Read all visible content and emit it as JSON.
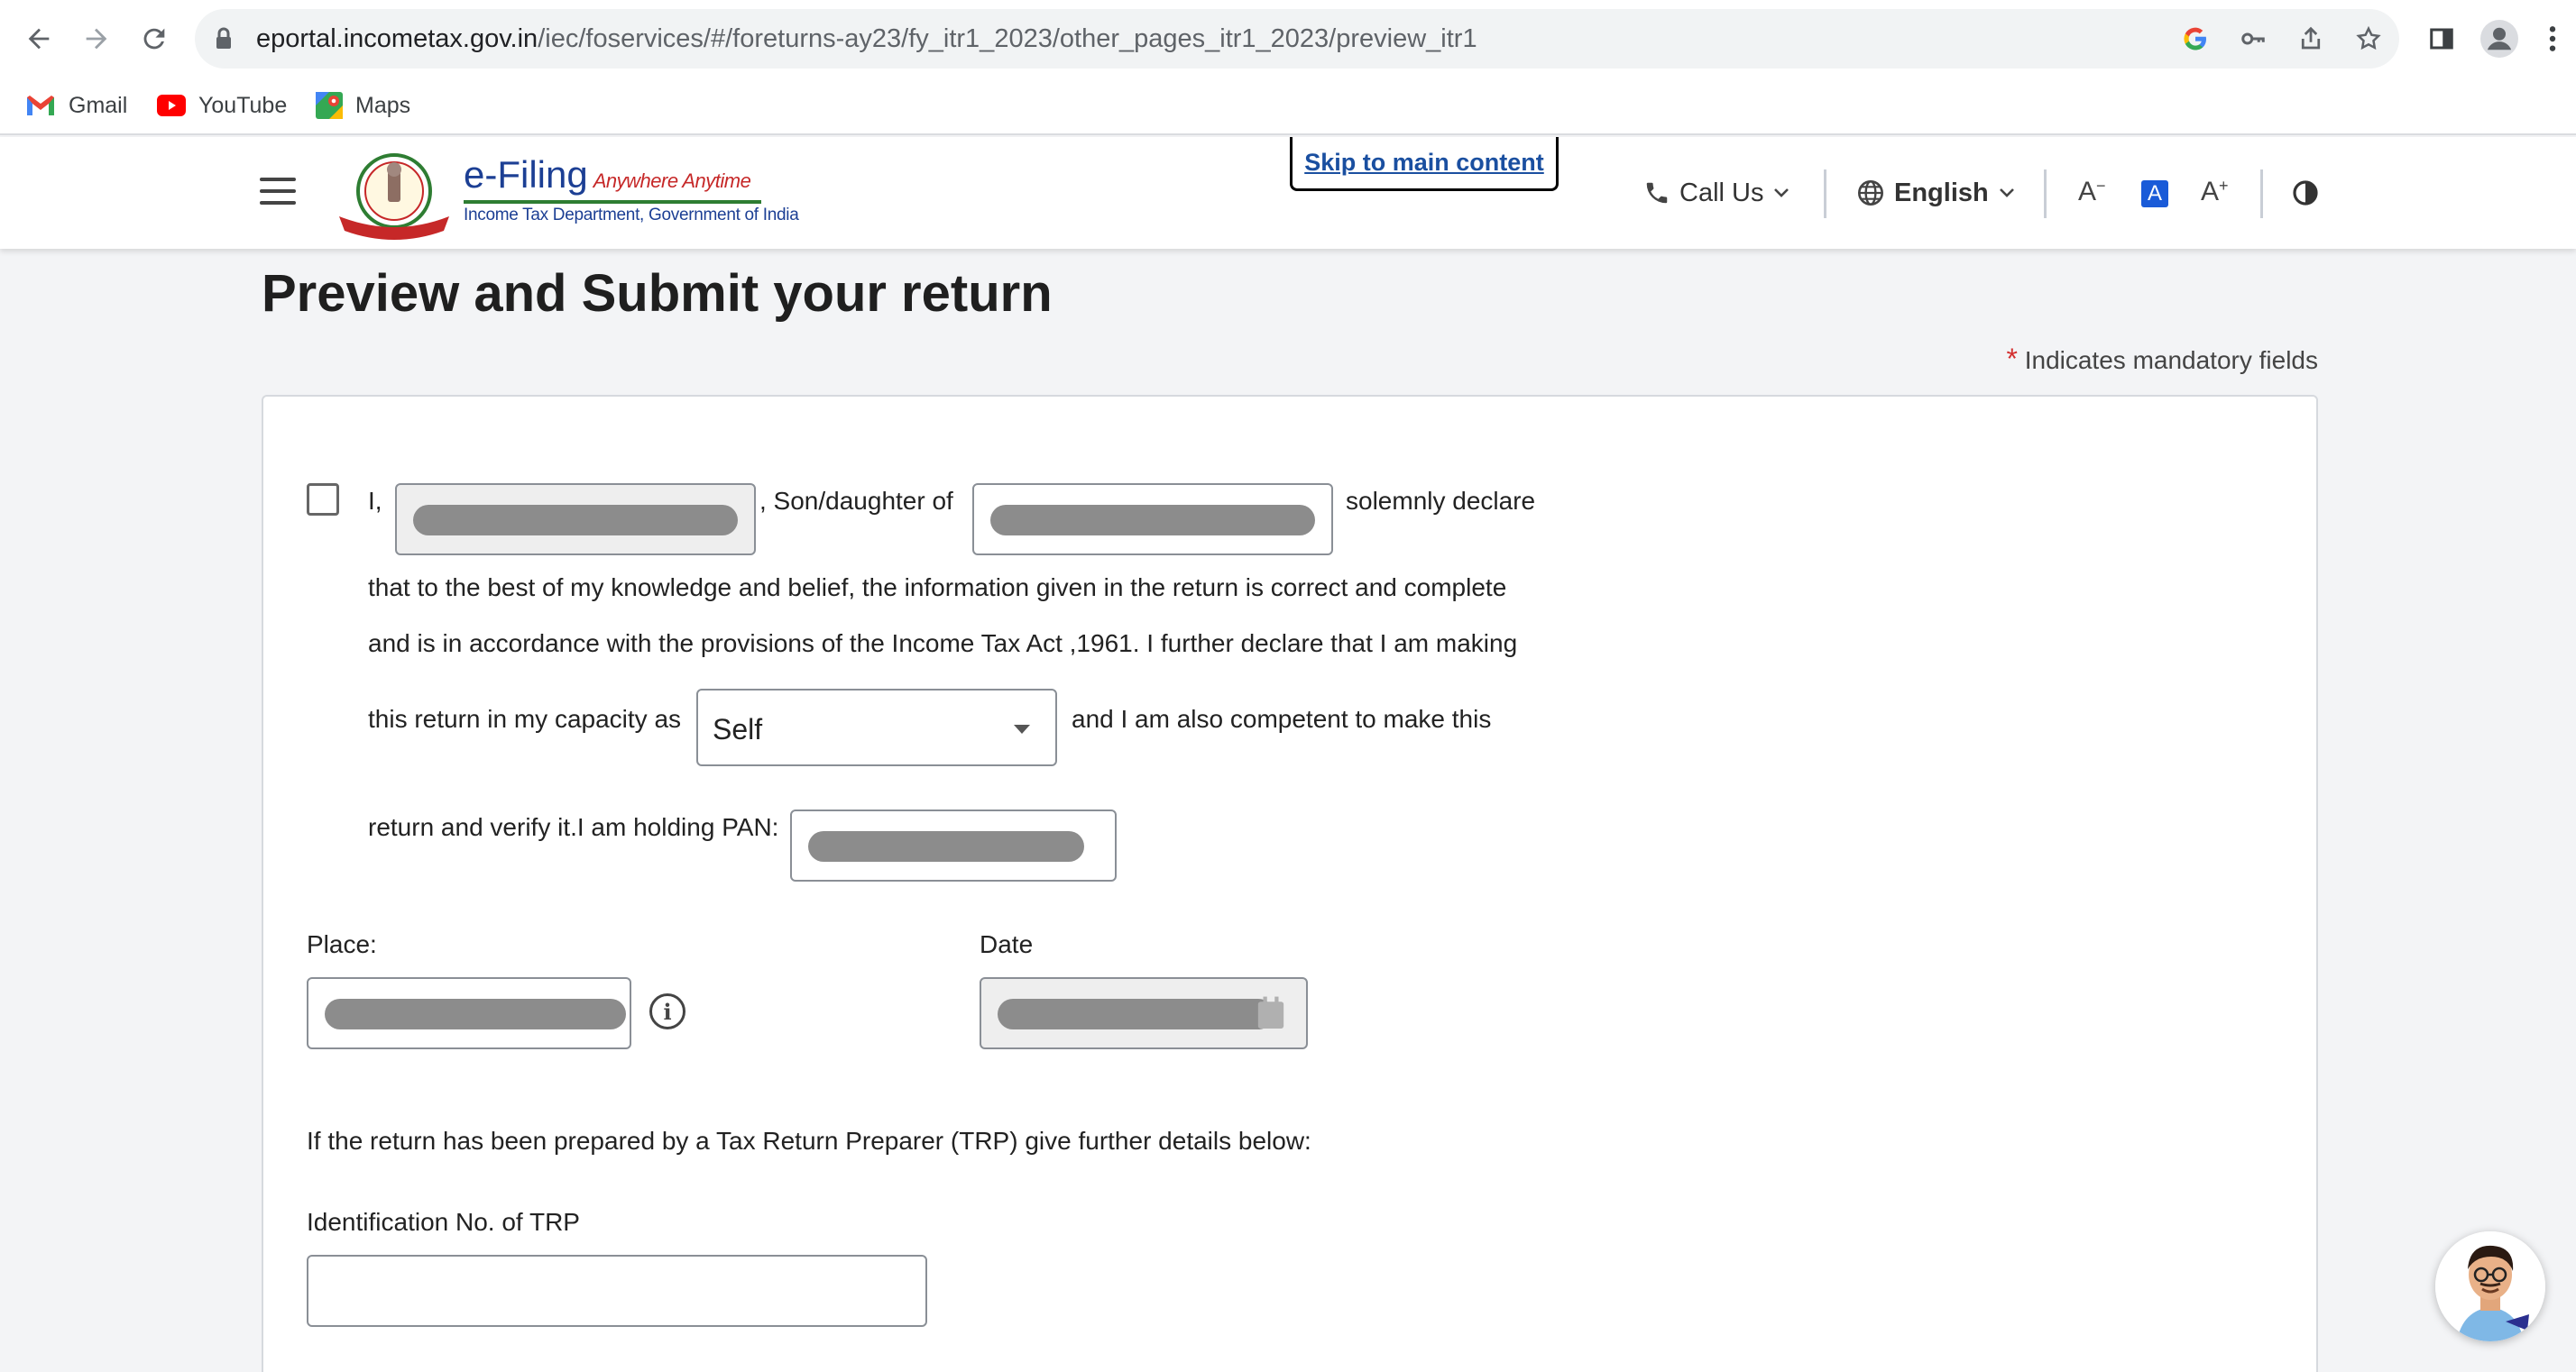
{
  "browser": {
    "url_host": "eportal.incometax.gov.in",
    "url_path": "/iec/foservices/#/foreturns-ay23/fy_itr1_2023/other_pages_itr1_2023/preview_itr1",
    "bookmarks": [
      {
        "label": "Gmail",
        "icon": "gmail-icon"
      },
      {
        "label": "YouTube",
        "icon": "youtube-icon"
      },
      {
        "label": "Maps",
        "icon": "maps-icon"
      }
    ]
  },
  "header": {
    "logo_title": "e-Filing",
    "logo_tagline": "Anywhere Anytime",
    "logo_subtitle": "Income Tax Department, Government of India",
    "skip_link": "Skip to main content",
    "call_us": "Call Us",
    "language": "English",
    "font_decrease": "A",
    "font_reset": "A",
    "font_increase": "A"
  },
  "main": {
    "page_title": "Preview and Submit your return",
    "mandatory_star": "*",
    "mandatory_note": "Indicates mandatory fields",
    "declaration": {
      "prefix": "I,",
      "son_daughter": ", Son/daughter of",
      "solemnly": "solemnly declare",
      "line2": "that to the best of my knowledge and belief, the information given in the return is correct and complete",
      "line3": "and is in accordance with the provisions of the Income Tax Act ,1961. I further declare that I am making",
      "capacity_prefix": "this return in my capacity as",
      "capacity_value": "Self",
      "capacity_suffix": "and I am also competent to make this",
      "pan_prefix": "return and verify it.I am holding PAN:"
    },
    "place_label": "Place:",
    "date_label": "Date",
    "trp_note": "If the return has been prepared by a Tax Return Preparer (TRP) give further details below:",
    "trp_id_label": "Identification No. of TRP",
    "trp_id_value": ""
  }
}
